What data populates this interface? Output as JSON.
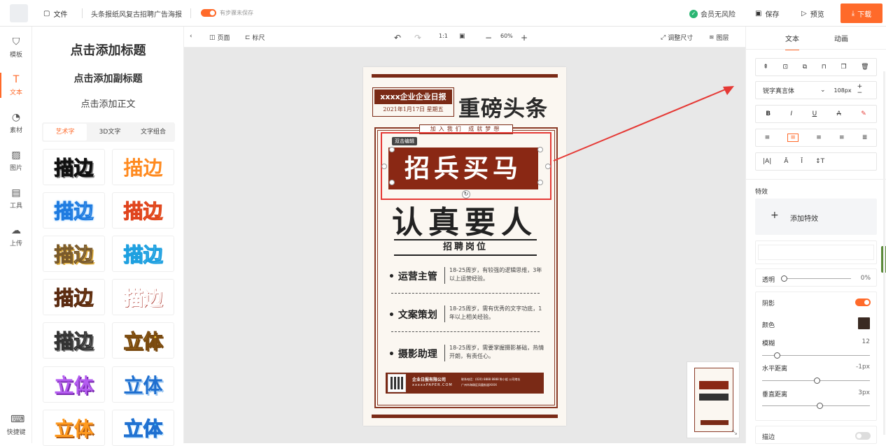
{
  "topbar": {
    "file_label": "文件",
    "doc_name": "头条报纸风复古招聘广告海报",
    "save_state": "有步骤未保存",
    "member": "会员无风险",
    "save": "保存",
    "preview": "预览",
    "download": "下载"
  },
  "leftnav": [
    {
      "label": "模板",
      "icon": "template-icon"
    },
    {
      "label": "文本",
      "icon": "text-icon"
    },
    {
      "label": "素材",
      "icon": "material-icon"
    },
    {
      "label": "图片",
      "icon": "image-icon"
    },
    {
      "label": "工具",
      "icon": "toolbox-icon"
    },
    {
      "label": "上传",
      "icon": "upload-cloud-icon"
    }
  ],
  "shortcut": "快捷键",
  "panel": {
    "add_title": "点击添加标题",
    "add_subtitle": "点击添加副标题",
    "add_body": "点击添加正文",
    "tabs": [
      "艺术字",
      "3D文字",
      "文字组合"
    ],
    "tiles": [
      "描边",
      "描边",
      "描边",
      "描边",
      "描边",
      "描边",
      "描边",
      "描边",
      "描边",
      "立体",
      "立体",
      "立体",
      "立体",
      "立体"
    ]
  },
  "canvas_toolbar": {
    "page": "页面",
    "ruler": "标尺",
    "ratio": "1:1",
    "zoom": "60%",
    "resize": "调整尺寸",
    "layers": "图层"
  },
  "poster": {
    "np_name": "xxxx企业企业日报",
    "np_date": "2021年1月17日  星期五",
    "headline": "重磅头条",
    "slogan": "加入我们 成就梦想",
    "main_title": "招兵买马",
    "edit_tag": "双击编辑",
    "sub_title": "认真要人",
    "jobs_title": "招聘岗位",
    "jobs": [
      {
        "name": "• 运营主管",
        "desc": "18-25周岁，有较强的逻辑思维，3年以上运营经验。"
      },
      {
        "name": "• 文案策划",
        "desc": "18-25周岁，需有优秀的文字功底，1年以上相关经验。"
      },
      {
        "name": "• 摄影助理",
        "desc": "18-25周岁，需要掌握摄影基础，热情开朗，有责任心。"
      }
    ],
    "footer_company": "企业日报有限公司",
    "footer_site": "xxxxxPAPER.COM",
    "footer_phone": "联系电话：(020) 8888 8888 陈小姐 公司地址",
    "footer_addr": "广州市海珠区凤凰街道XXXX"
  },
  "rightpanel": {
    "tabs": [
      "文本",
      "动画"
    ],
    "font": "锐字真言体",
    "font_size": "108px",
    "effects_label": "特效",
    "add_effect": "添加特效",
    "opacity_label": "透明",
    "opacity_value": "0%",
    "shadow_label": "阴影",
    "color_label": "颜色",
    "shadow_color": "#3a2a22",
    "blur_label": "模糊",
    "blur_value": "12",
    "hdist_label": "水平距离",
    "hdist_value": "-1px",
    "vdist_label": "垂直距离",
    "vdist_value": "3px",
    "stroke_label": "描边"
  },
  "colors": {
    "accent": "#ff6a2a",
    "poster_red": "#7a2a16",
    "selection": "#e53935"
  }
}
